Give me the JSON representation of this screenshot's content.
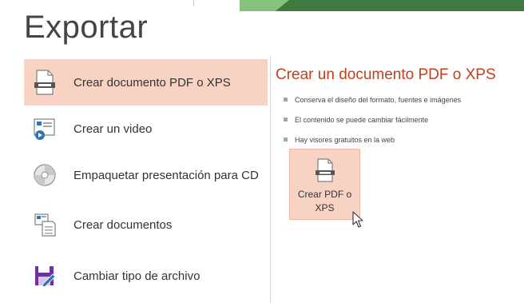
{
  "title": "Exportar",
  "menu": [
    {
      "label": "Crear documento PDF o XPS",
      "icon": "pdf-document-icon",
      "selected": true
    },
    {
      "label": "Crear un video",
      "icon": "video-icon",
      "selected": false
    },
    {
      "label": "Empaquetar presentación para CD",
      "icon": "cd-icon",
      "selected": false
    },
    {
      "label": "Crear documentos",
      "icon": "handouts-icon",
      "selected": false
    },
    {
      "label": "Cambiar tipo de archivo",
      "icon": "change-file-type-icon",
      "selected": false
    }
  ],
  "detail": {
    "heading": "Crear un documento PDF o XPS",
    "bullets": [
      "Conserva el diseño del formato, fuentes e imágenes",
      "El contenido se puede cambiar fácilmente",
      "Hay visores gratuitos en la web"
    ],
    "button_label": "Crear PDF o\nXPS"
  },
  "colors": {
    "selected_bg": "#f8d3c4",
    "heading": "#c43e1c",
    "accent_green": "#3f7a3f"
  }
}
